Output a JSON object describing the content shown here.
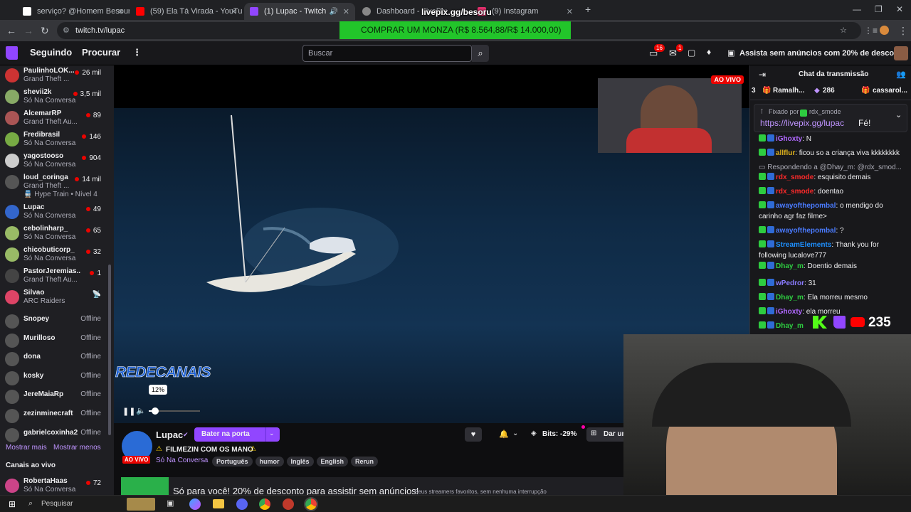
{
  "browser": {
    "tabs": [
      {
        "title": "serviço? @Homem Besouro #y",
        "color": "#ffffff"
      },
      {
        "title": "(59) Ela Tá Virada - YouTube",
        "color": "#ff0000"
      },
      {
        "title": "(1) Lupac - Twitch",
        "color": "#9146ff"
      },
      {
        "title": "Dashboard - LivePix",
        "color": "#888888"
      },
      {
        "title": "(9) Instagram",
        "color": "#e1306c"
      }
    ],
    "url": "twitch.tv/lupac"
  },
  "overlay": {
    "livepix_url": "livepix.gg/besoru",
    "banner_text": "COMPRAR UM MONZA (R$ 8.564,88/R$ 14.000,00)",
    "counter": "235"
  },
  "topnav": {
    "following": "Seguindo",
    "browse": "Procurar",
    "search_placeholder": "Buscar",
    "notif_count": "16",
    "inbox_count": "1",
    "prime_text": "Assista sem anúncios com 20% de desconto"
  },
  "sidebar": {
    "channels": [
      {
        "name": "PaulinhoLOK...",
        "game": "Grand Theft ...",
        "viewers": "26 mil",
        "color": "#c33"
      },
      {
        "name": "shevii2k",
        "game": "Só Na Conversa",
        "viewers": "3,5 mil",
        "color": "#8a6"
      },
      {
        "name": "AlcemarRP",
        "game": "Grand Theft Au...",
        "viewers": "89",
        "color": "#a55"
      },
      {
        "name": "Fredibrasil",
        "game": "Só Na Conversa",
        "viewers": "146",
        "color": "#7a4"
      },
      {
        "name": "yagostooso",
        "game": "Só Na Conversa",
        "viewers": "904",
        "color": "#ccc"
      },
      {
        "name": "loud_coringa",
        "game": "Grand Theft ...",
        "viewers": "14 mil",
        "color": "#555",
        "extra": "Hype Train • Nível 4"
      },
      {
        "name": "Lupac",
        "game": "Só Na Conversa",
        "viewers": "49",
        "color": "#36c"
      },
      {
        "name": "cebolinharp_",
        "game": "Só Na Conversa",
        "viewers": "65",
        "color": "#9b6"
      },
      {
        "name": "chicobuticorp_",
        "game": "Só Na Conversa",
        "viewers": "32",
        "color": "#9b6"
      },
      {
        "name": "PastorJeremias...",
        "game": "Grand Theft Au...",
        "viewers": "1",
        "color": "#444"
      },
      {
        "name": "Silvao",
        "game": "ARC Raiders",
        "viewers": "",
        "color": "#d46"
      }
    ],
    "offline": [
      {
        "name": "Snopey",
        "status": "Offline"
      },
      {
        "name": "Murilloso",
        "status": "Offline"
      },
      {
        "name": "dona",
        "status": "Offline"
      },
      {
        "name": "kosky",
        "status": "Offline"
      },
      {
        "name": "JereMaiaRp",
        "status": "Offline"
      },
      {
        "name": "zezinminecraft",
        "status": "Offline"
      },
      {
        "name": "gabrielcoxinha2",
        "status": "Offline"
      }
    ],
    "show_more": "Mostrar mais",
    "show_less": "Mostrar menos",
    "live_header": "Canais ao vivo",
    "live_channel": {
      "name": "RobertaHaas",
      "game": "Só Na Conversa",
      "viewers": "72"
    }
  },
  "player": {
    "live_label": "AO VIVO",
    "watermark": "REDECANAIS",
    "volume_tip": "12%",
    "volume_level": 0.12
  },
  "info": {
    "channel": "Lupac",
    "raid_button": "Bater na porta",
    "title": "FILMEZIN COM OS MANO",
    "category": "Só Na Conversa",
    "live_label": "AO VIVO",
    "tags": [
      "Português",
      "humor",
      "Inglês",
      "English",
      "Rerun"
    ],
    "bits_label": "Bits: -29%",
    "gift_label": "Dar um",
    "promo_text": "Só para você! 20% de desconto para assistir sem anúncios!",
    "promo_sub": "Seus streamers favoritos, sem nenhuma interrupção"
  },
  "chat": {
    "title": "Chat da transmissão",
    "leaderboard": [
      {
        "rank": "3",
        "name": "Ramalh...",
        "score": "286"
      },
      {
        "rank": "",
        "name": "cassarol...",
        "score": ""
      }
    ],
    "pinned_by": "Fixado por",
    "pinned_user": "rdx_smode",
    "pinned_link": "https://livepix.gg/lupac",
    "pinned_suffix": "Fé!",
    "messages": [
      {
        "user": "iGhoxty",
        "text": ": N",
        "color": "#b068ff"
      },
      {
        "user": "allflur",
        "text": ": ficou so a criança viva kkkkkkkk",
        "color": "#dcb01c"
      },
      {
        "user": "",
        "text": "Respondendo a @Dhay_m: @rdx_smod...",
        "color": "#adadb8"
      },
      {
        "user": "rdx_smode",
        "text": ": esquisito demais",
        "color": "#ff2a2a"
      },
      {
        "user": "rdx_smode",
        "text": ": doentao",
        "color": "#ff2a2a"
      },
      {
        "user": "awayofthepombal",
        "text": ": o mendigo do carinho agr faz filme>",
        "color": "#4a7bff"
      },
      {
        "user": "awayofthepombal",
        "text": ": ?",
        "color": "#4a7bff"
      },
      {
        "user": "StreamElements",
        "text": ": Thank you for following lucalove777",
        "color": "#1e90ff"
      },
      {
        "user": "Dhay_m",
        "text": ": Doentio demais",
        "color": "#2ecc40"
      },
      {
        "user": "wPedror",
        "text": ": 31",
        "color": "#8a7bff"
      },
      {
        "user": "Dhay_m",
        "text": ": Ela morreu mesmo",
        "color": "#2ecc40"
      },
      {
        "user": "iGhoxty",
        "text": ": ela morreu",
        "color": "#b068ff"
      },
      {
        "user": "Dhay_m",
        "text": "",
        "color": "#2ecc40"
      }
    ]
  },
  "taskbar": {
    "search": "Pesquisar"
  }
}
